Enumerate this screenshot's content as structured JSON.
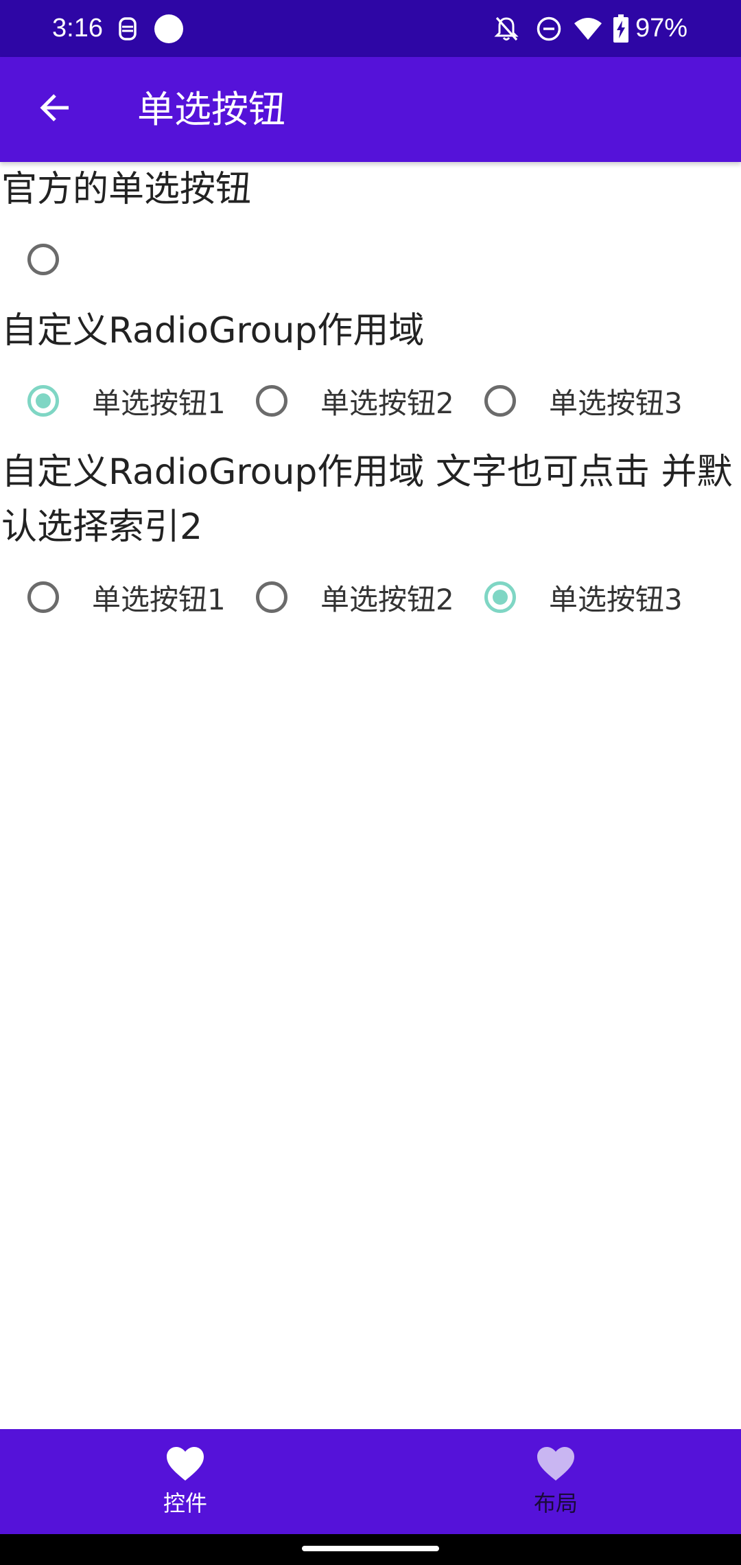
{
  "status_bar": {
    "time": "3:16",
    "battery": "97%",
    "background": "#2e06a5",
    "icons": [
      "face-unlock-icon",
      "notification-dot-icon",
      "notifications-off-icon",
      "do-not-disturb-icon",
      "wifi-icon",
      "battery-charging-icon"
    ]
  },
  "app_bar": {
    "title": "单选按钮",
    "background": "#5512d9",
    "back_icon": "back-arrow-icon"
  },
  "sections": [
    {
      "label": "官方的单选按钮",
      "options": [
        {
          "label": "",
          "checked": false
        }
      ]
    },
    {
      "label": "自定义RadioGroup作用域",
      "options": [
        {
          "label": "单选按钮1",
          "checked": true
        },
        {
          "label": "单选按钮2",
          "checked": false
        },
        {
          "label": "单选按钮3",
          "checked": false
        }
      ]
    },
    {
      "label": "自定义RadioGroup作用域 文字也可点击 并默认选择索引2",
      "options": [
        {
          "label": "单选按钮1",
          "checked": false
        },
        {
          "label": "单选按钮2",
          "checked": false
        },
        {
          "label": "单选按钮3",
          "checked": true
        }
      ]
    }
  ],
  "radio_colors": {
    "checked": "#7fd6c4",
    "unchecked": "#6b6b6b"
  },
  "bottom_nav": {
    "background": "#5512d9",
    "items": [
      {
        "label": "控件",
        "icon": "heart-icon",
        "selected": true,
        "color": "#ffffff"
      },
      {
        "label": "布局",
        "icon": "heart-icon",
        "selected": false,
        "color": "#c9b6f2"
      }
    ]
  }
}
